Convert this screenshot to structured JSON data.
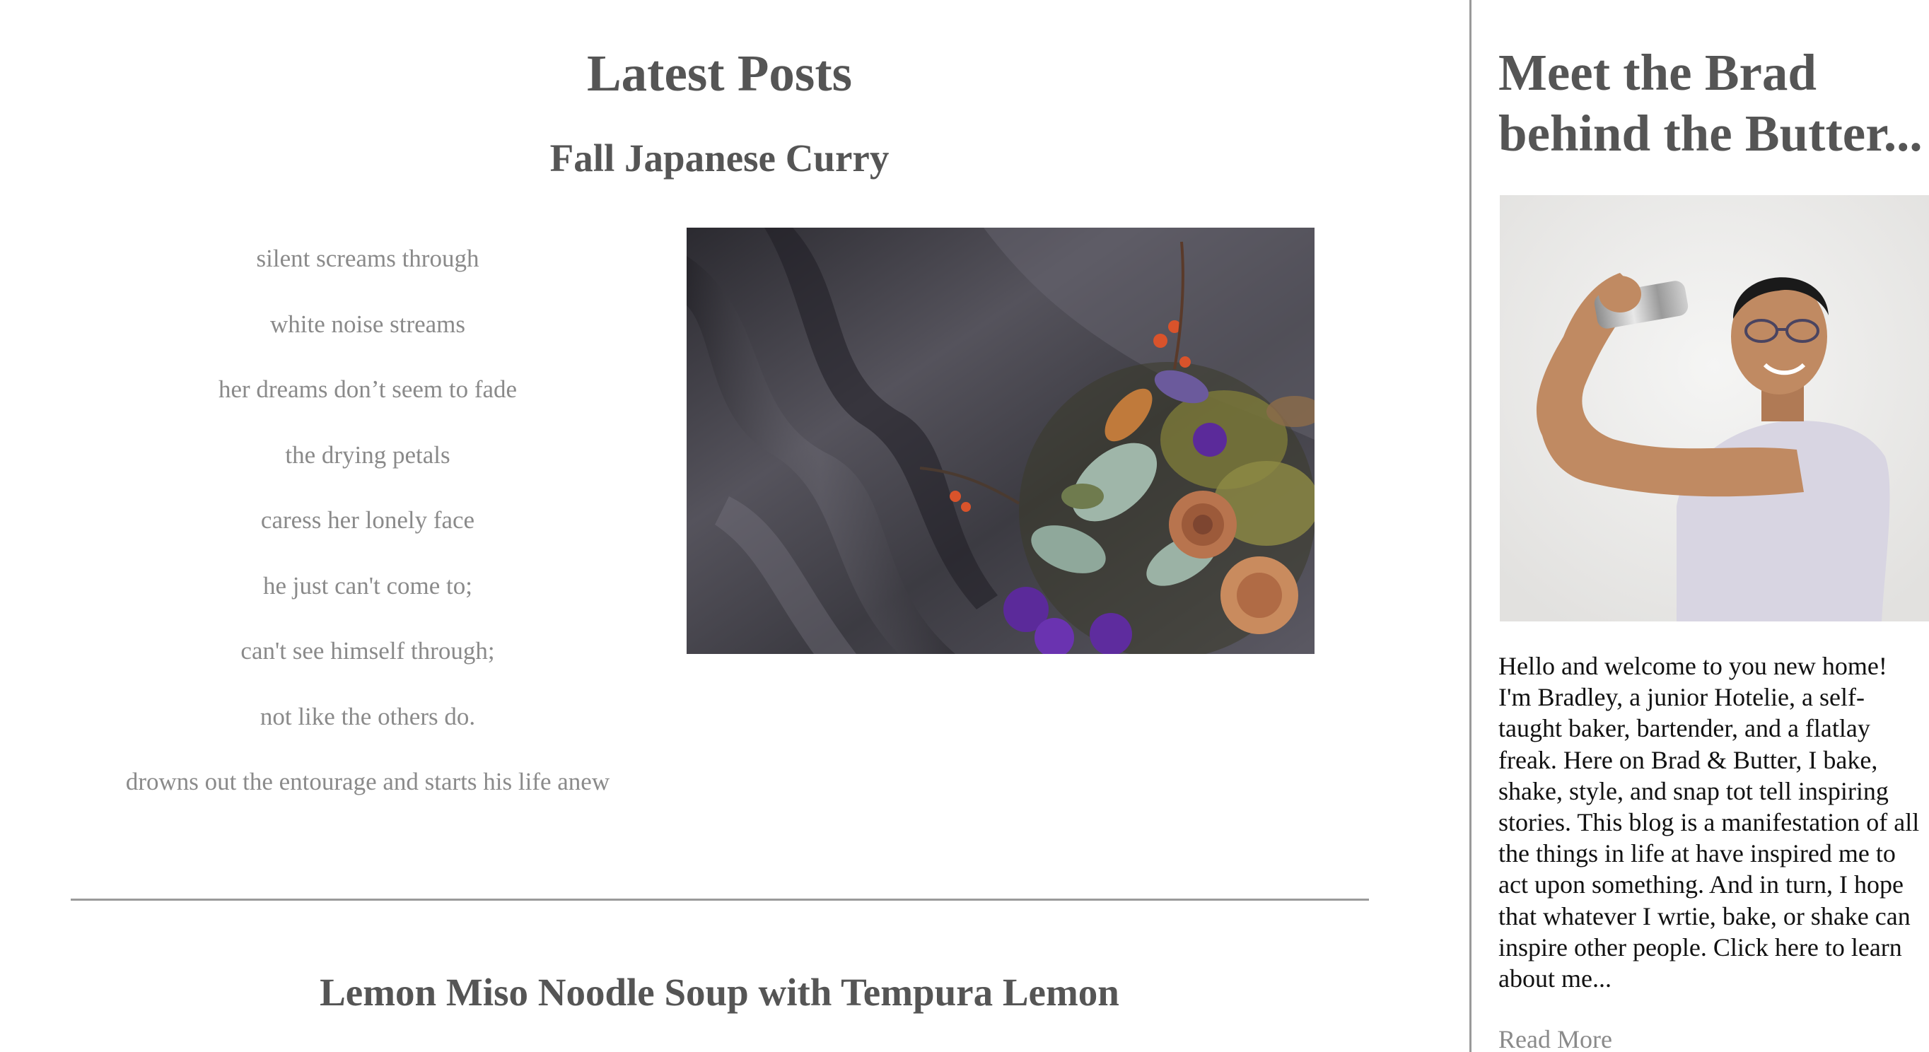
{
  "main": {
    "heading": "Latest Posts",
    "posts": [
      {
        "title": "Fall Japanese Curry",
        "poem_lines": [
          "silent screams through",
          "white noise streams",
          "her dreams don’t seem to fade",
          "the drying petals",
          "caress her lonely face",
          "he just can't come to;",
          "can't see himself through;",
          "not like the others do.",
          "drowns out the entourage and starts his life anew"
        ],
        "image_subject": "dried-flower-bouquet-on-velvet"
      },
      {
        "title": "Lemon Miso Noodle Soup with Tempura Lemon"
      }
    ]
  },
  "sidebar": {
    "title": "Meet the Brad behind the Butter...",
    "photo_subject": "man-shaking-cocktail-shaker",
    "bio": "Hello and welcome to you new home! I'm Bradley, a junior Hotelie, a self-taught baker, bartender, and a flatlay freak. Here on Brad & Butter, I bake, shake, style, and snap tot tell inspiring stories. This blog is a manifestation of all the things in life at have inspired me to act upon something. And in turn, I hope that whatever I wrtie, bake, or shake can inspire other people. Click here to learn about me...",
    "read_more_label": "Read More"
  },
  "colors": {
    "heading": "#555555",
    "poem_text": "#8a8a8a",
    "body_text": "#111111",
    "divider": "#9a9a9a",
    "link": "#8a8a8a"
  }
}
